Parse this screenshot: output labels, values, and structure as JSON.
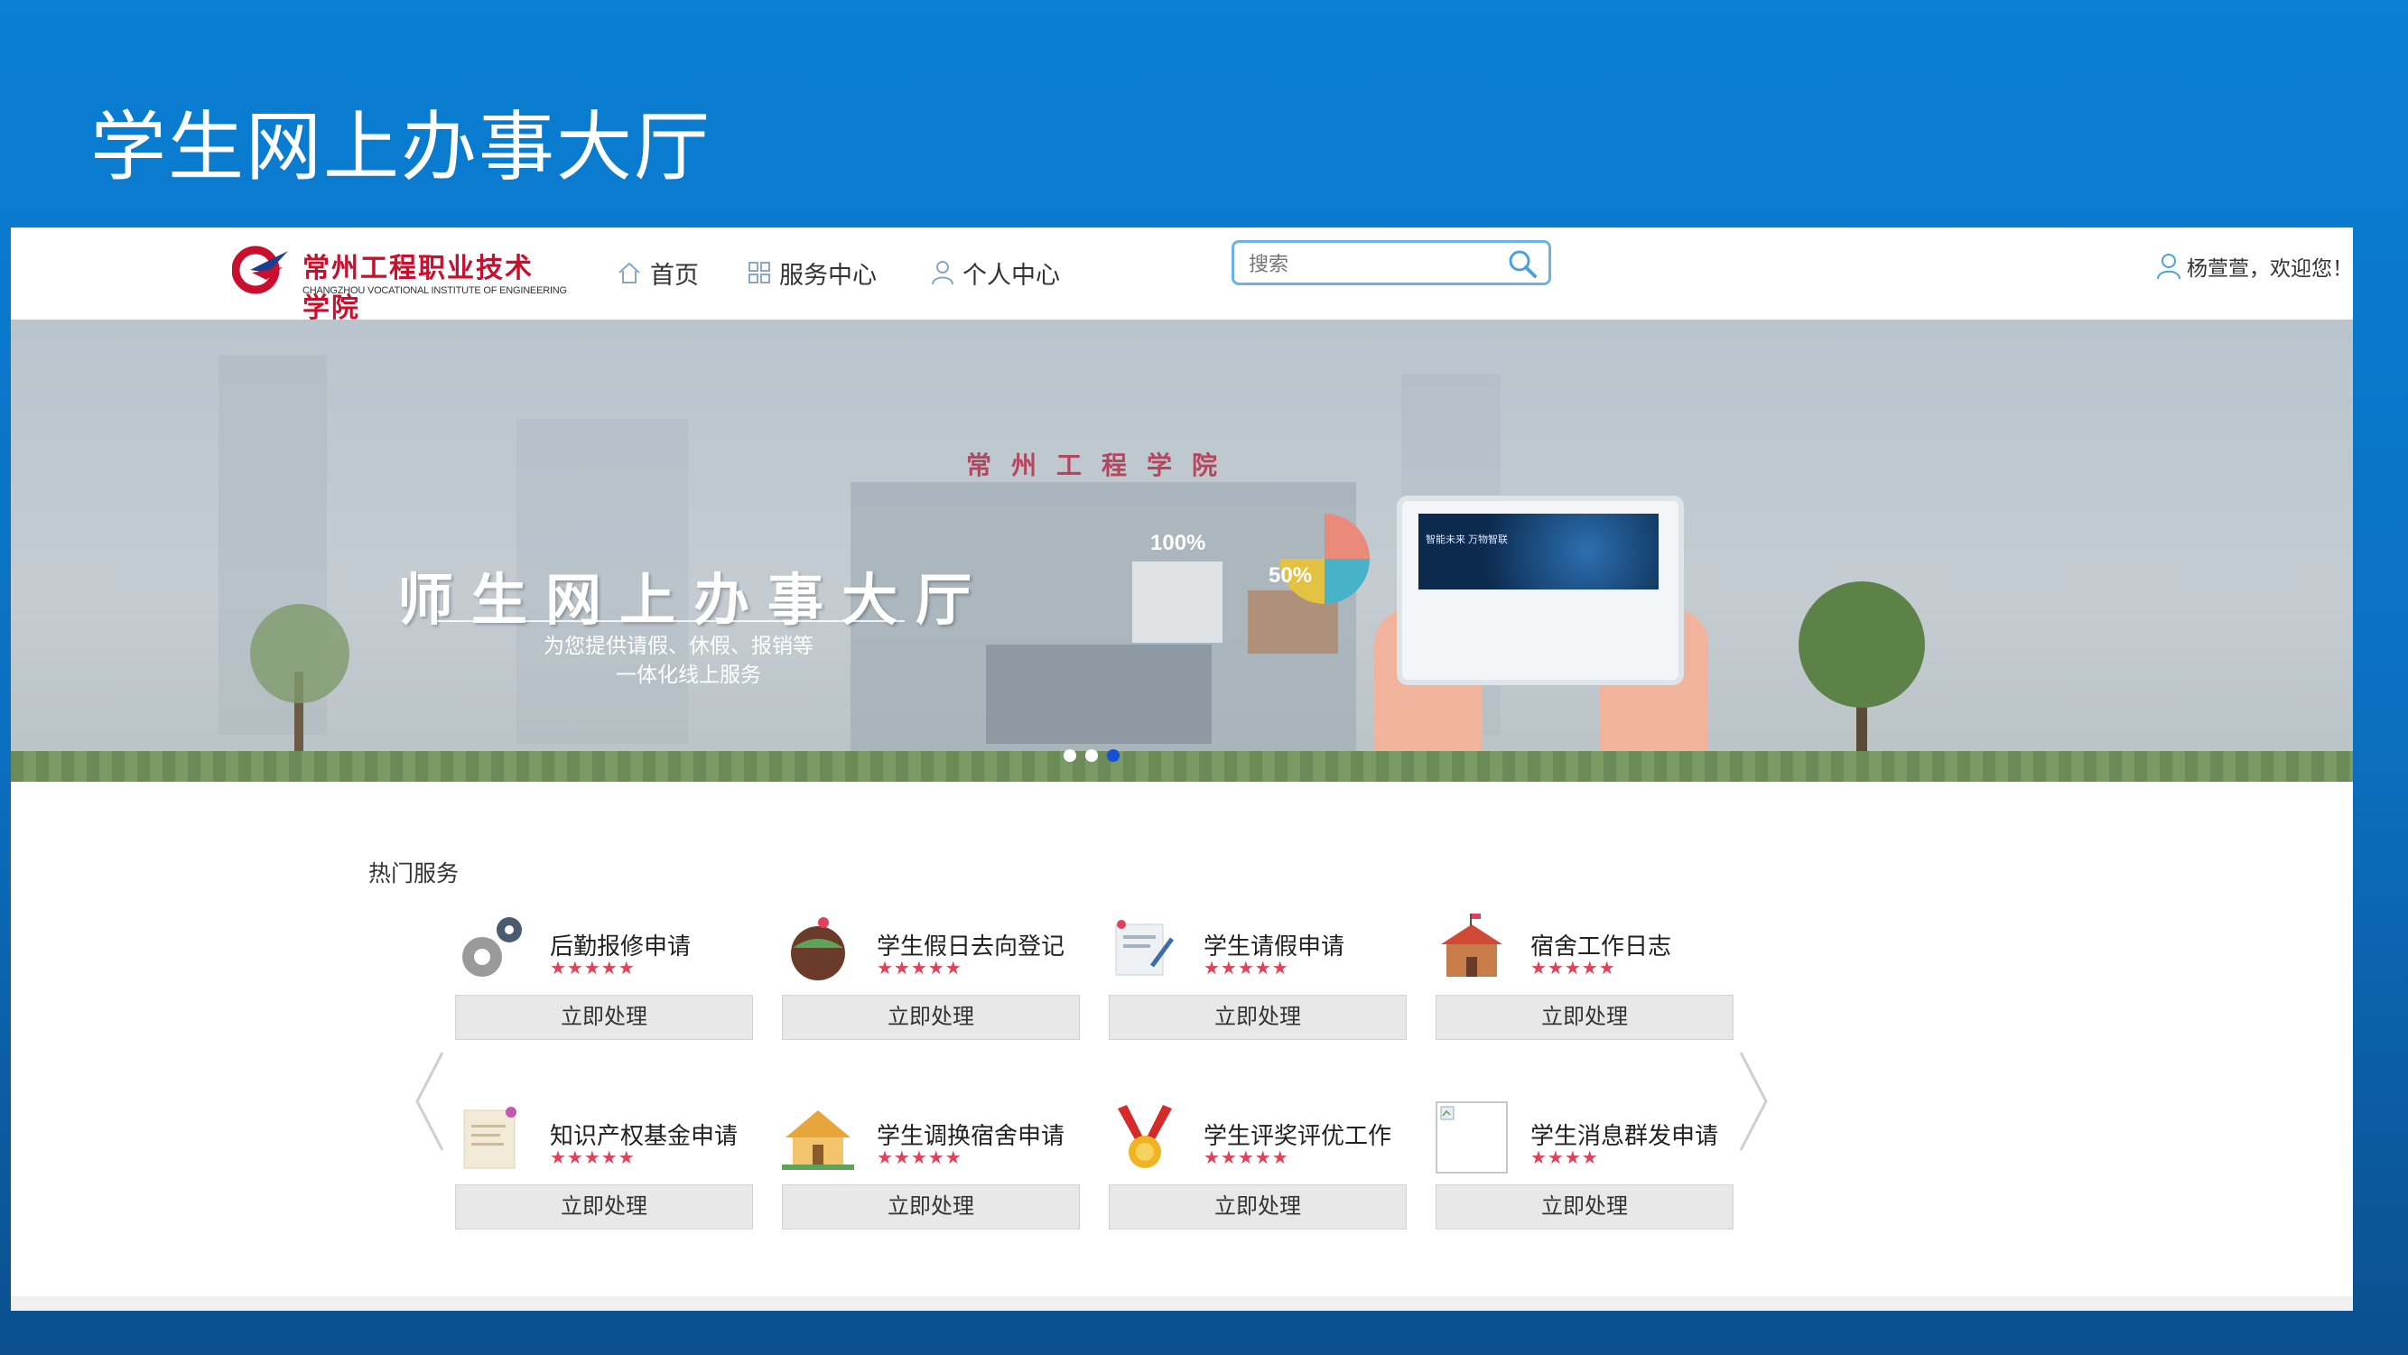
{
  "slide": {
    "title": "学生网上办事大厅"
  },
  "header": {
    "logo_cn": "常州工程职业技术学院",
    "logo_en": "CHANGZHOU VOCATIONAL INSTITUTE OF ENGINEERING",
    "nav": [
      {
        "label": "首页",
        "icon": "home-icon"
      },
      {
        "label": "服务中心",
        "icon": "grid-icon"
      },
      {
        "label": "个人中心",
        "icon": "user-icon"
      }
    ],
    "search": {
      "placeholder": "搜索",
      "icon": "search-icon"
    },
    "user": {
      "greeting": "杨萱萱，欢迎您！",
      "icon": "user-icon"
    },
    "accent_color": "#6ab3e6"
  },
  "banner": {
    "school": "常州工程学院",
    "headline": "师生网上办事大厅",
    "subline1": "为您提供请假、休假、报销等",
    "subline2": "一体化线上服务",
    "stat_100": "100%",
    "stat_50": "50%",
    "tablet_caption": "智能未来 万物智联",
    "carousel": {
      "slides": 3,
      "active_index": 2
    }
  },
  "hot_services": {
    "title": "热门服务",
    "items": [
      {
        "name": "后勤报修申请",
        "stars": "★★★★★",
        "rating": 5,
        "action": "立即处理",
        "icon": "gear-icon"
      },
      {
        "name": "学生假日去向登记",
        "stars": "★★★★★",
        "rating": 5,
        "action": "立即处理",
        "icon": "globe-icon"
      },
      {
        "name": "学生请假申请",
        "stars": "★★★★★",
        "rating": 5,
        "action": "立即处理",
        "icon": "document-pen-icon"
      },
      {
        "name": "宿舍工作日志",
        "stars": "★★★★★",
        "rating": 5,
        "action": "立即处理",
        "icon": "school-house-icon"
      },
      {
        "name": "知识产权基金申请",
        "stars": "★★★★★",
        "rating": 5,
        "action": "立即处理",
        "icon": "note-icon"
      },
      {
        "name": "学生调换宿舍申请",
        "stars": "★★★★★",
        "rating": 5,
        "action": "立即处理",
        "icon": "house-icon"
      },
      {
        "name": "学生评奖评优工作",
        "stars": "★★★★★",
        "rating": 5,
        "action": "立即处理",
        "icon": "medal-icon"
      },
      {
        "name": "学生消息群发申请",
        "stars": "★★★★",
        "rating": 4,
        "action": "立即处理",
        "icon": "broken-image-icon"
      }
    ],
    "star_color": "#e0425a"
  }
}
